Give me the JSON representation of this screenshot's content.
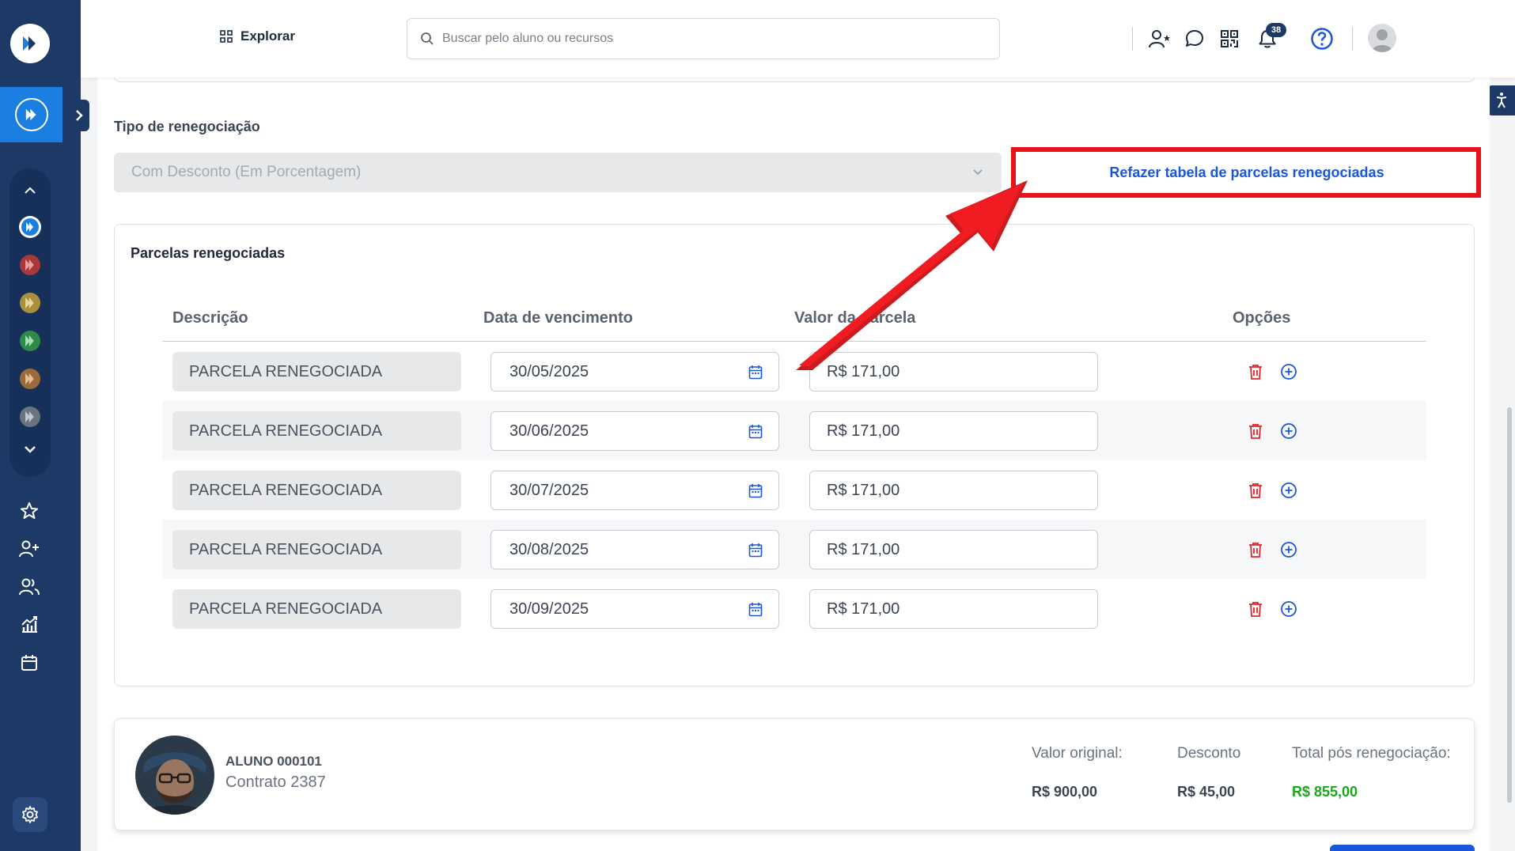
{
  "topbar": {
    "explore_label": "Explorar",
    "search_placeholder": "Buscar pelo aluno ou recursos",
    "notification_count": "38"
  },
  "form": {
    "tipo_label": "Tipo de renegociação",
    "tipo_value": "Com Desconto (Em Porcentagem)",
    "redo_button_label": "Refazer tabela de parcelas renegociadas"
  },
  "parcelas": {
    "title": "Parcelas renegociadas",
    "headers": {
      "descricao": "Descrição",
      "data": "Data de vencimento",
      "valor": "Valor da parcela",
      "opcoes": "Opções"
    },
    "rows": [
      {
        "descricao": "PARCELA RENEGOCIADA",
        "data": "30/05/2025",
        "valor": "R$ 171,00"
      },
      {
        "descricao": "PARCELA RENEGOCIADA",
        "data": "30/06/2025",
        "valor": "R$ 171,00"
      },
      {
        "descricao": "PARCELA RENEGOCIADA",
        "data": "30/07/2025",
        "valor": "R$ 171,00"
      },
      {
        "descricao": "PARCELA RENEGOCIADA",
        "data": "30/08/2025",
        "valor": "R$ 171,00"
      },
      {
        "descricao": "PARCELA RENEGOCIADA",
        "data": "30/09/2025",
        "valor": "R$ 171,00"
      }
    ]
  },
  "summary": {
    "student_name": "ALUNO 000101",
    "contract": "Contrato 2387",
    "original_label": "Valor original:",
    "original_value": "R$ 900,00",
    "discount_label": "Desconto",
    "discount_value": "R$ 45,00",
    "total_label": "Total pós renegociação:",
    "total_value": "R$ 855,00"
  },
  "colors": {
    "sidebar": "#1d3a66",
    "accent_blue": "#1a56db",
    "highlight_red": "#e8121a",
    "total_green": "#18a81a",
    "trash_red": "#e0242a"
  },
  "icons": {
    "sidebar": [
      "app-logo-icon",
      "star-icon",
      "user-plus-icon",
      "users-icon",
      "chart-icon",
      "calendar-icon",
      "gear-icon"
    ],
    "topbar": [
      "grid-icon",
      "search-icon",
      "user-star-icon",
      "chat-icon",
      "qr-code-icon",
      "bell-icon",
      "help-icon"
    ],
    "row_options": [
      "trash-icon",
      "plus-circle-icon"
    ]
  }
}
